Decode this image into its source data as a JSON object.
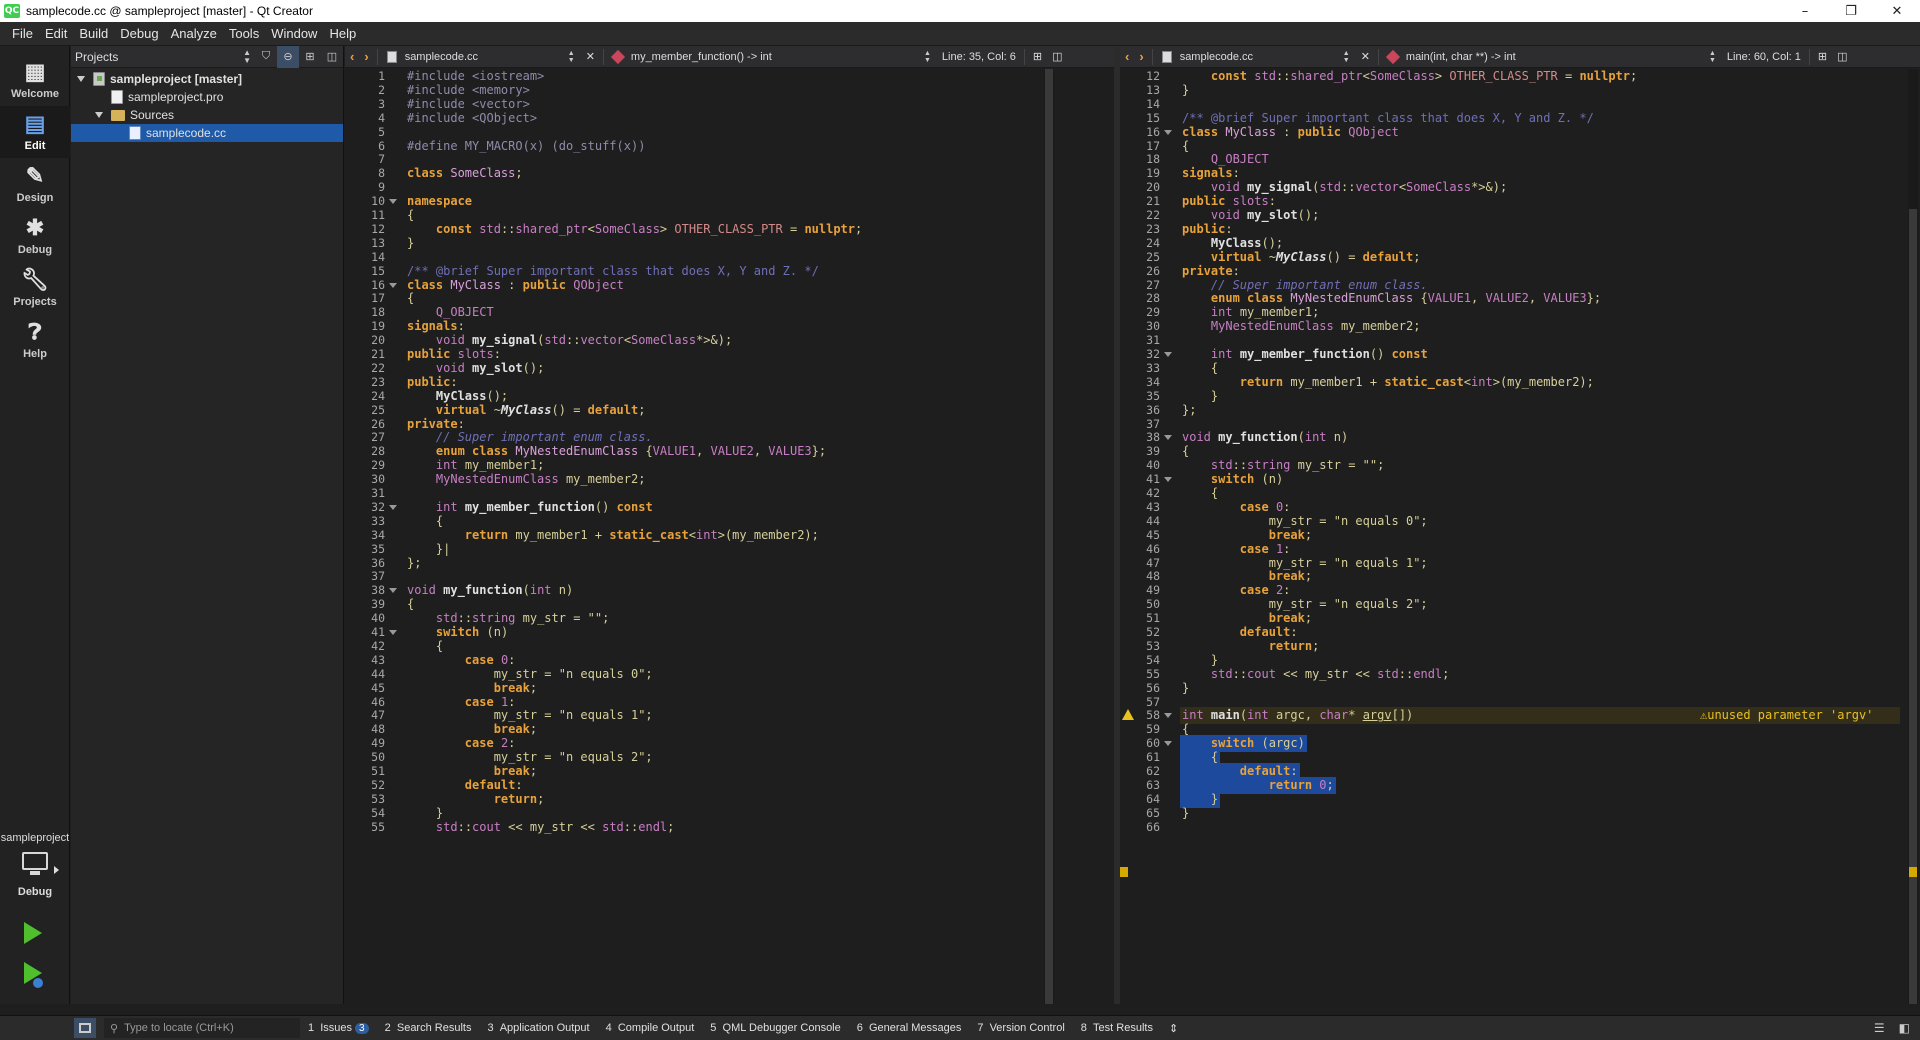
{
  "window": {
    "title": "samplecode.cc @ sampleproject [master] - Qt Creator",
    "app_icon": "QC",
    "minimize": "–",
    "restore": "❐",
    "close": "✕"
  },
  "menu": [
    "File",
    "Edit",
    "Build",
    "Debug",
    "Analyze",
    "Tools",
    "Window",
    "Help"
  ],
  "modes": [
    {
      "label": "Welcome",
      "icon": "grid-icon"
    },
    {
      "label": "Edit",
      "icon": "edit-icon"
    },
    {
      "label": "Design",
      "icon": "pencil-icon"
    },
    {
      "label": "Debug",
      "icon": "bug-icon"
    },
    {
      "label": "Projects",
      "icon": "wrench-icon"
    },
    {
      "label": "Help",
      "icon": "help-icon"
    }
  ],
  "kit": {
    "project": "sampleproject",
    "build": "Debug"
  },
  "sidebar": {
    "view": "Projects",
    "tree": [
      {
        "label": "sampleproject [master]",
        "level": 0
      },
      {
        "label": "sampleproject.pro",
        "level": 1
      },
      {
        "label": "Sources",
        "level": 1
      },
      {
        "label": "samplecode.cc",
        "level": 2,
        "selected": true
      }
    ]
  },
  "left_editor": {
    "file": "samplecode.cc",
    "symbol": "my_member_function() -> int",
    "position": "Line: 35, Col: 6"
  },
  "right_editor": {
    "file": "samplecode.cc",
    "symbol": "main(int, char **) -> int",
    "position": "Line: 60, Col: 1",
    "warning": "unused parameter 'argv'"
  },
  "statusbar": {
    "locator_placeholder": "Type to locate (Ctrl+K)",
    "panes": [
      {
        "num": "1",
        "label": "Issues",
        "badge": "3"
      },
      {
        "num": "2",
        "label": "Search Results"
      },
      {
        "num": "3",
        "label": "Application Output"
      },
      {
        "num": "4",
        "label": "Compile Output"
      },
      {
        "num": "5",
        "label": "QML Debugger Console"
      },
      {
        "num": "6",
        "label": "General Messages"
      },
      {
        "num": "7",
        "label": "Version Control"
      },
      {
        "num": "8",
        "label": "Test Results"
      }
    ]
  },
  "colors": {
    "keyword": "#e8a23b",
    "type": "#c87fc4",
    "comment": "#6f6fb7",
    "selection": "#1d4a9c",
    "warning": "#e8c020"
  },
  "code_left": [
    {
      "n": 1,
      "html": "<span class='pp'>#include &lt;iostream&gt;</span>"
    },
    {
      "n": 2,
      "html": "<span class='pp'>#include &lt;memory&gt;</span>"
    },
    {
      "n": 3,
      "html": "<span class='pp'>#include &lt;vector&gt;</span>"
    },
    {
      "n": 4,
      "html": "<span class='pp'>#include &lt;QObject&gt;</span>"
    },
    {
      "n": 5,
      "html": ""
    },
    {
      "n": 6,
      "html": "<span class='pp'>#define MY_MACRO(x) (do_stuff(x))</span>"
    },
    {
      "n": 7,
      "html": ""
    },
    {
      "n": 8,
      "html": "<span class='kw'>class</span> <span class='cls'>SomeClass</span>;"
    },
    {
      "n": 9,
      "html": ""
    },
    {
      "n": 10,
      "html": "<span class='kw'>namespace</span>",
      "fold": true
    },
    {
      "n": 11,
      "html": "{"
    },
    {
      "n": 12,
      "html": "    <span class='kw'>const</span> <span class='ty'>std</span>::<span class='ty'>shared_ptr</span>&lt;<span class='ty'>SomeClass</span>&gt; <span class='mac'>OTHER_CLASS_PTR</span> = <span class='kw'>nullptr</span>;"
    },
    {
      "n": 13,
      "html": "}"
    },
    {
      "n": 14,
      "html": ""
    },
    {
      "n": 15,
      "html": "<span class='cm'>/** @brief Super important class that does X, Y and Z. */</span>"
    },
    {
      "n": 16,
      "html": "<span class='kw'>class</span> <span class='cls'>MyClass</span> : <span class='kw'>public</span> <span class='ty'>QObject</span>",
      "fold": true
    },
    {
      "n": 17,
      "html": "{"
    },
    {
      "n": 18,
      "html": "    <span class='ty'>Q_OBJECT</span>"
    },
    {
      "n": 19,
      "html": "<span class='kw'>signals</span>:"
    },
    {
      "n": 20,
      "html": "    <span class='ty'>void</span> <span class='fn'>my_signal</span>(<span class='ty'>std</span>::<span class='ty'>vector</span>&lt;<span class='ty'>SomeClass</span>*&gt;&amp;);"
    },
    {
      "n": 21,
      "html": "<span class='kw'>public</span> <span class='ty'>slots</span>:"
    },
    {
      "n": 22,
      "html": "    <span class='ty'>void</span> <span class='fn'>my_slot</span>();"
    },
    {
      "n": 23,
      "html": "<span class='kw'>public</span>:"
    },
    {
      "n": 24,
      "html": "    <span class='fn'>MyClass</span>();"
    },
    {
      "n": 25,
      "html": "    <span class='kw'>virtual</span> ~<span class='fn it'>MyClass</span>() = <span class='kw'>default</span>;"
    },
    {
      "n": 26,
      "html": "<span class='kw'>private</span>:"
    },
    {
      "n": 27,
      "html": "    <span class='cm it'>// Super important enum class.</span>"
    },
    {
      "n": 28,
      "html": "    <span class='kw'>enum class</span> <span class='cls'>MyNestedEnumClass</span> {<span class='ty'>VALUE1</span>, <span class='ty'>VALUE2</span>, <span class='ty'>VALUE3</span>};"
    },
    {
      "n": 29,
      "html": "    <span class='ty'>int</span> my_member1;"
    },
    {
      "n": 30,
      "html": "    <span class='ty'>MyNestedEnumClass</span> my_member2;"
    },
    {
      "n": 31,
      "html": ""
    },
    {
      "n": 32,
      "html": "    <span class='ty'>int</span> <span class='fn'>my_member_function</span>() <span class='kw'>const</span>",
      "fold": true
    },
    {
      "n": 33,
      "html": "    {"
    },
    {
      "n": 34,
      "html": "        <span class='kw'>return</span> my_member1 + <span class='kw'>static_cast</span>&lt;<span class='ty'>int</span>&gt;(my_member2);"
    },
    {
      "n": 35,
      "html": "    }|"
    },
    {
      "n": 36,
      "html": "};"
    },
    {
      "n": 37,
      "html": ""
    },
    {
      "n": 38,
      "html": "<span class='ty'>void</span> <span class='fn'>my_function</span>(<span class='ty'>int</span> n)",
      "fold": true
    },
    {
      "n": 39,
      "html": "{"
    },
    {
      "n": 40,
      "html": "    <span class='ty'>std</span>::<span class='ty'>string</span> my_str = <span class='st'>\"\"</span>;"
    },
    {
      "n": 41,
      "html": "    <span class='kw'>switch</span> (n)",
      "fold": true
    },
    {
      "n": 42,
      "html": "    {"
    },
    {
      "n": 43,
      "html": "        <span class='kw'>case</span> <span class='ty'>0</span>:"
    },
    {
      "n": 44,
      "html": "            my_str = <span class='st'>\"n equals 0\"</span>;"
    },
    {
      "n": 45,
      "html": "            <span class='kw'>break</span>;"
    },
    {
      "n": 46,
      "html": "        <span class='kw'>case</span> <span class='ty'>1</span>:"
    },
    {
      "n": 47,
      "html": "            my_str = <span class='st'>\"n equals 1\"</span>;"
    },
    {
      "n": 48,
      "html": "            <span class='kw'>break</span>;"
    },
    {
      "n": 49,
      "html": "        <span class='kw'>case</span> <span class='ty'>2</span>:"
    },
    {
      "n": 50,
      "html": "            my_str = <span class='st'>\"n equals 2\"</span>;"
    },
    {
      "n": 51,
      "html": "            <span class='kw'>break</span>;"
    },
    {
      "n": 52,
      "html": "        <span class='kw'>default</span>:"
    },
    {
      "n": 53,
      "html": "            <span class='kw'>return</span>;"
    },
    {
      "n": 54,
      "html": "    }"
    },
    {
      "n": 55,
      "html": "    <span class='ty'>std</span>::<span class='ty'>cout</span> &lt;&lt; my_str &lt;&lt; <span class='ty'>std</span>::<span class='ty'>endl</span>;"
    }
  ],
  "code_right": [
    {
      "n": 12,
      "html": "    <span class='kw'>const</span> <span class='ty'>std</span>::<span class='ty'>shared_ptr</span>&lt;<span class='ty'>SomeClass</span>&gt; <span class='mac'>OTHER_CLASS_PTR</span> = <span class='kw'>nullptr</span>;"
    },
    {
      "n": 13,
      "html": "}"
    },
    {
      "n": 14,
      "html": ""
    },
    {
      "n": 15,
      "html": "<span class='cm'>/** @brief Super important class that does X, Y and Z. */</span>"
    },
    {
      "n": 16,
      "html": "<span class='kw'>class</span> <span class='cls'>MyClass</span> : <span class='kw'>public</span> <span class='ty'>QObject</span>",
      "fold": true
    },
    {
      "n": 17,
      "html": "{"
    },
    {
      "n": 18,
      "html": "    <span class='ty'>Q_OBJECT</span>"
    },
    {
      "n": 19,
      "html": "<span class='kw'>signals</span>:"
    },
    {
      "n": 20,
      "html": "    <span class='ty'>void</span> <span class='fn'>my_signal</span>(<span class='ty'>std</span>::<span class='ty'>vector</span>&lt;<span class='ty'>SomeClass</span>*&gt;&amp;);"
    },
    {
      "n": 21,
      "html": "<span class='kw'>public</span> <span class='ty'>slots</span>:"
    },
    {
      "n": 22,
      "html": "    <span class='ty'>void</span> <span class='fn'>my_slot</span>();"
    },
    {
      "n": 23,
      "html": "<span class='kw'>public</span>:"
    },
    {
      "n": 24,
      "html": "    <span class='fn'>MyClass</span>();"
    },
    {
      "n": 25,
      "html": "    <span class='kw'>virtual</span> ~<span class='fn it'>MyClass</span>() = <span class='kw'>default</span>;"
    },
    {
      "n": 26,
      "html": "<span class='kw'>private</span>:"
    },
    {
      "n": 27,
      "html": "    <span class='cm it'>// Super important enum class.</span>"
    },
    {
      "n": 28,
      "html": "    <span class='kw'>enum class</span> <span class='cls'>MyNestedEnumClass</span> {<span class='ty'>VALUE1</span>, <span class='ty'>VALUE2</span>, <span class='ty'>VALUE3</span>};"
    },
    {
      "n": 29,
      "html": "    <span class='ty'>int</span> my_member1;"
    },
    {
      "n": 30,
      "html": "    <span class='ty'>MyNestedEnumClass</span> my_member2;"
    },
    {
      "n": 31,
      "html": ""
    },
    {
      "n": 32,
      "html": "    <span class='ty'>int</span> <span class='fn'>my_member_function</span>() <span class='kw'>const</span>",
      "fold": true
    },
    {
      "n": 33,
      "html": "    {"
    },
    {
      "n": 34,
      "html": "        <span class='kw'>return</span> my_member1 + <span class='kw'>static_cast</span>&lt;<span class='ty'>int</span>&gt;(my_member2);"
    },
    {
      "n": 35,
      "html": "    }"
    },
    {
      "n": 36,
      "html": "};"
    },
    {
      "n": 37,
      "html": ""
    },
    {
      "n": 38,
      "html": "<span class='ty'>void</span> <span class='fn'>my_function</span>(<span class='ty'>int</span> n)",
      "fold": true
    },
    {
      "n": 39,
      "html": "{"
    },
    {
      "n": 40,
      "html": "    <span class='ty'>std</span>::<span class='ty'>string</span> my_str = <span class='st'>\"\"</span>;"
    },
    {
      "n": 41,
      "html": "    <span class='kw'>switch</span> (n)",
      "fold": true
    },
    {
      "n": 42,
      "html": "    {"
    },
    {
      "n": 43,
      "html": "        <span class='kw'>case</span> <span class='ty'>0</span>:"
    },
    {
      "n": 44,
      "html": "            my_str = <span class='st'>\"n equals 0\"</span>;"
    },
    {
      "n": 45,
      "html": "            <span class='kw'>break</span>;"
    },
    {
      "n": 46,
      "html": "        <span class='kw'>case</span> <span class='ty'>1</span>:"
    },
    {
      "n": 47,
      "html": "            my_str = <span class='st'>\"n equals 1\"</span>;"
    },
    {
      "n": 48,
      "html": "            <span class='kw'>break</span>;"
    },
    {
      "n": 49,
      "html": "        <span class='kw'>case</span> <span class='ty'>2</span>:"
    },
    {
      "n": 50,
      "html": "            my_str = <span class='st'>\"n equals 2\"</span>;"
    },
    {
      "n": 51,
      "html": "            <span class='kw'>break</span>;"
    },
    {
      "n": 52,
      "html": "        <span class='kw'>default</span>:"
    },
    {
      "n": 53,
      "html": "            <span class='kw'>return</span>;"
    },
    {
      "n": 54,
      "html": "    }"
    },
    {
      "n": 55,
      "html": "    <span class='ty'>std</span>::<span class='ty'>cout</span> &lt;&lt; my_str &lt;&lt; <span class='ty'>std</span>::<span class='ty'>endl</span>;"
    },
    {
      "n": 56,
      "html": "}"
    },
    {
      "n": 57,
      "html": ""
    },
    {
      "n": 58,
      "html": "<span class='ty'>int</span> <span class='fn'>main</span>(<span class='ty'>int</span> argc, <span class='ty'>char</span>* <u>argv</u>[])",
      "fold": true,
      "warn": true
    },
    {
      "n": 59,
      "html": "{"
    },
    {
      "n": 60,
      "html": "    <span class='kw'>switch</span> (argc)",
      "fold": true,
      "sel": true
    },
    {
      "n": 61,
      "html": "    {",
      "sel": true
    },
    {
      "n": 62,
      "html": "        <span class='kw'>default</span>:",
      "sel": true
    },
    {
      "n": 63,
      "html": "            <span class='kw'>return</span> <span class='ty'>0</span>;",
      "sel": true
    },
    {
      "n": 64,
      "html": "    }",
      "sel": true
    },
    {
      "n": 65,
      "html": "}"
    },
    {
      "n": 66,
      "html": ""
    }
  ]
}
